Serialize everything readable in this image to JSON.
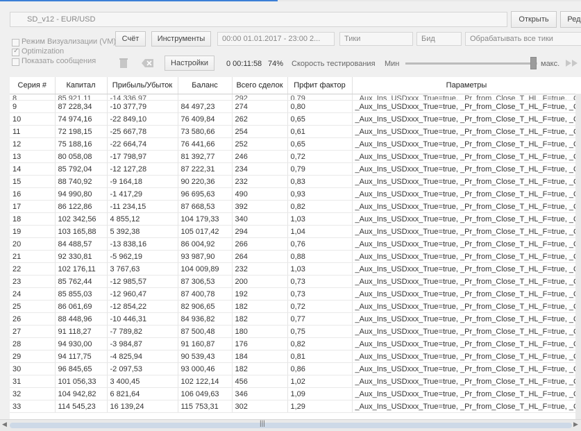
{
  "window": {
    "title": "SD_v12 - EUR/USD"
  },
  "toolbar": {
    "open_label": "Открыть",
    "edit_label": "Ред",
    "account_label": "Счёт",
    "instruments_label": "Инструменты",
    "date_range": "00:00 01.01.2017 - 23:00 2...",
    "ticks_placeholder": "Тики",
    "bid_placeholder": "Бид",
    "process_label": "Обрабатывать все тики",
    "settings_label": "Настройки"
  },
  "options": {
    "visual_mode": "Режим Визуализации (VM)",
    "optimization": "Optimization",
    "show_messages": "Показать сообщения"
  },
  "status": {
    "elapsed": "0 00:11:58",
    "percent": "74%",
    "speed_label": "Скорость тестирования",
    "min_label": "Мин",
    "max_label": "макс.",
    "speed_level": 0.95
  },
  "table": {
    "headers": [
      "Серия #",
      "Капитал",
      "Прибыль/Убыток",
      "Баланс",
      "Всего сделок",
      "Прфит фактор",
      "Параметры"
    ],
    "partial_row": [
      "8",
      "85 921,11",
      "-14 336,97",
      "",
      "292",
      "0,79",
      "_Aux_Ins_USDxxx_True=true, _Pr_from_Close_T_HL_F=true, _Qu"
    ],
    "rows": [
      [
        "9",
        "87 228,34",
        "-10 377,79",
        "84 497,23",
        "274",
        "0,80",
        "_Aux_Ins_USDxxx_True=true, _Pr_from_Close_T_HL_F=true, _Qu"
      ],
      [
        "10",
        "74 974,16",
        "-22 849,10",
        "76 409,84",
        "262",
        "0,65",
        "_Aux_Ins_USDxxx_True=true, _Pr_from_Close_T_HL_F=true, _Qu"
      ],
      [
        "11",
        "72 198,15",
        "-25 667,78",
        "73 580,66",
        "254",
        "0,61",
        "_Aux_Ins_USDxxx_True=true, _Pr_from_Close_T_HL_F=true, _Qu"
      ],
      [
        "12",
        "75 188,16",
        "-22 664,74",
        "76 441,66",
        "252",
        "0,65",
        "_Aux_Ins_USDxxx_True=true, _Pr_from_Close_T_HL_F=true, _Qu"
      ],
      [
        "13",
        "80 058,08",
        "-17 798,97",
        "81 392,77",
        "246",
        "0,72",
        "_Aux_Ins_USDxxx_True=true, _Pr_from_Close_T_HL_F=true, _Qu"
      ],
      [
        "14",
        "85 792,04",
        "-12 127,28",
        "87 222,31",
        "234",
        "0,79",
        "_Aux_Ins_USDxxx_True=true, _Pr_from_Close_T_HL_F=true, _Qu"
      ],
      [
        "15",
        "88 740,92",
        "-9 164,18",
        "90 220,36",
        "232",
        "0,83",
        "_Aux_Ins_USDxxx_True=true, _Pr_from_Close_T_HL_F=true, _Qu"
      ],
      [
        "16",
        "94 990,80",
        "-1 417,29",
        "96 695,63",
        "490",
        "0,93",
        "_Aux_Ins_USDxxx_True=true, _Pr_from_Close_T_HL_F=true, _Qu"
      ],
      [
        "17",
        "86 122,86",
        "-11 234,15",
        "87 668,53",
        "392",
        "0,82",
        "_Aux_Ins_USDxxx_True=true, _Pr_from_Close_T_HL_F=true, _Qu"
      ],
      [
        "18",
        "102 342,56",
        "4 855,12",
        "104 179,33",
        "340",
        "1,03",
        "_Aux_Ins_USDxxx_True=true, _Pr_from_Close_T_HL_F=true, _Qu"
      ],
      [
        "19",
        "103 165,88",
        "5 392,38",
        "105 017,42",
        "294",
        "1,04",
        "_Aux_Ins_USDxxx_True=true, _Pr_from_Close_T_HL_F=true, _Qu"
      ],
      [
        "20",
        "84 488,57",
        "-13 838,16",
        "86 004,92",
        "266",
        "0,76",
        "_Aux_Ins_USDxxx_True=true, _Pr_from_Close_T_HL_F=true, _Qu"
      ],
      [
        "21",
        "92 330,81",
        "-5 962,19",
        "93 987,90",
        "264",
        "0,88",
        "_Aux_Ins_USDxxx_True=true, _Pr_from_Close_T_HL_F=true, _Qu"
      ],
      [
        "22",
        "102 176,11",
        "3 767,63",
        "104 009,89",
        "232",
        "1,03",
        "_Aux_Ins_USDxxx_True=true, _Pr_from_Close_T_HL_F=true, _Qu"
      ],
      [
        "23",
        "85 762,44",
        "-12 985,57",
        "87 306,53",
        "200",
        "0,73",
        "_Aux_Ins_USDxxx_True=true, _Pr_from_Close_T_HL_F=true, _Qu"
      ],
      [
        "24",
        "85 855,03",
        "-12 960,47",
        "87 400,78",
        "192",
        "0,73",
        "_Aux_Ins_USDxxx_True=true, _Pr_from_Close_T_HL_F=true, _Qu"
      ],
      [
        "25",
        "86 061,69",
        "-12 854,22",
        "82 906,65",
        "182",
        "0,72",
        "_Aux_Ins_USDxxx_True=true, _Pr_from_Close_T_HL_F=true, _Qu"
      ],
      [
        "26",
        "88 448,96",
        "-10 446,31",
        "84 936,82",
        "182",
        "0,77",
        "_Aux_Ins_USDxxx_True=true, _Pr_from_Close_T_HL_F=true, _Qu"
      ],
      [
        "27",
        "91 118,27",
        "-7 789,82",
        "87 500,48",
        "180",
        "0,75",
        "_Aux_Ins_USDxxx_True=true, _Pr_from_Close_T_HL_F=true, _Qu"
      ],
      [
        "28",
        "94 930,00",
        "-3 984,87",
        "91 160,87",
        "176",
        "0,82",
        "_Aux_Ins_USDxxx_True=true, _Pr_from_Close_T_HL_F=true, _Qu"
      ],
      [
        "29",
        "94 117,75",
        "-4 825,94",
        "90 539,43",
        "184",
        "0,81",
        "_Aux_Ins_USDxxx_True=true, _Pr_from_Close_T_HL_F=true, _Qu"
      ],
      [
        "30",
        "96 845,65",
        "-2 097,53",
        "93 000,46",
        "182",
        "0,86",
        "_Aux_Ins_USDxxx_True=true, _Pr_from_Close_T_HL_F=true, _Qu"
      ],
      [
        "31",
        "101 056,33",
        "3 400,45",
        "102 122,14",
        "456",
        "1,02",
        "_Aux_Ins_USDxxx_True=true, _Pr_from_Close_T_HL_F=true, _Qu"
      ],
      [
        "32",
        "104 942,82",
        "6 821,64",
        "106 049,63",
        "346",
        "1,09",
        "_Aux_Ins_USDxxx_True=true, _Pr_from_Close_T_HL_F=true, _Qu"
      ],
      [
        "33",
        "114 545,23",
        "16 139,24",
        "115 753,31",
        "302",
        "1,29",
        "_Aux_Ins_USDxxx_True=true, _Pr_from_Close_T_HL_F=true, _Qu"
      ]
    ]
  }
}
